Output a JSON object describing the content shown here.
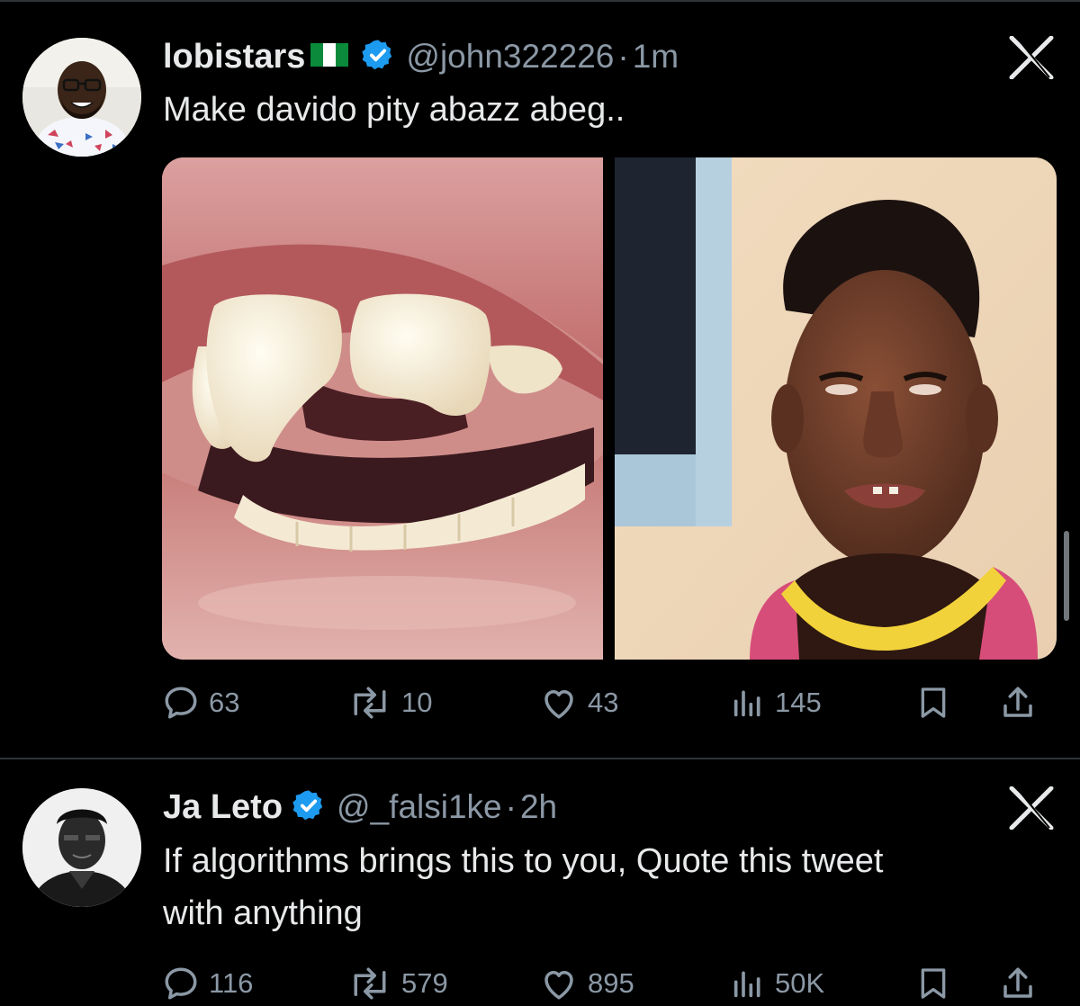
{
  "colors": {
    "background": "#000000",
    "text": "#e7e9ea",
    "muted": "#8b98a5",
    "verified": "#1d9bf0",
    "divider": "#2f3336"
  },
  "tweets": [
    {
      "name": "lobistars",
      "flag": "nigeria-flag-icon",
      "handle": "@john322226",
      "dot": "·",
      "time": "1m",
      "text": "Make davido pity abazz abeg..",
      "media": [
        "mouth-chipped-teeth-photo",
        "man-gap-tooth-photo"
      ],
      "stats": {
        "replies": "63",
        "retweets": "10",
        "likes": "43",
        "views": "145"
      }
    },
    {
      "name": "Ja Leto",
      "handle": "@_falsi1ke",
      "dot": "·",
      "time": "2h",
      "text_line1": "If algorithms brings this to you, Quote this tweet",
      "text_line2": "with anything",
      "stats": {
        "replies": "116",
        "retweets": "579",
        "likes": "895",
        "views": "50K"
      }
    }
  ]
}
